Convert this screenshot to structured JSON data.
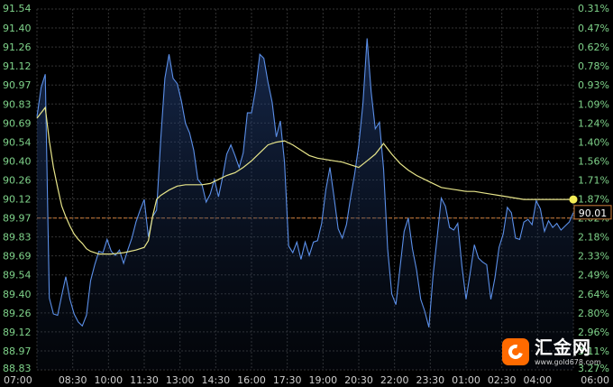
{
  "chart_data": {
    "type": "line",
    "y_ticks_left": [
      "91.54",
      "91.40",
      "91.26",
      "91.12",
      "90.97",
      "90.83",
      "90.69",
      "90.54",
      "90.40",
      "90.26",
      "90.12",
      "89.97",
      "89.83",
      "89.69",
      "89.54",
      "89.40",
      "89.26",
      "89.12",
      "88.97",
      "88.83"
    ],
    "y_ticks_right": [
      "0.31%",
      "0.47%",
      "0.62%",
      "0.78%",
      "0.93%",
      "1.09%",
      "1.24%",
      "1.40%",
      "1.56%",
      "1.71%",
      "1.87%",
      "2.02%",
      "2.18%",
      "2.33%",
      "2.49%",
      "2.64%",
      "2.80%",
      "2.96%",
      "3.11%",
      "3.27%"
    ],
    "x_ticks": [
      "07:00",
      "08:30",
      "10:00",
      "11:30",
      "13:00",
      "14:30",
      "16:00",
      "17:30",
      "19:00",
      "20:30",
      "22:00",
      "23:30",
      "01:00",
      "02:30",
      "04:00",
      "06:00"
    ],
    "ylim": [
      88.83,
      91.54
    ],
    "reference_value": 89.97,
    "current_value_label": "90.01",
    "grid": true,
    "series": [
      {
        "color": "#5b8fe8",
        "points": [
          [
            0,
            90.73
          ],
          [
            1,
            90.95
          ],
          [
            2,
            91.05
          ],
          [
            3,
            89.37
          ],
          [
            4,
            89.25
          ],
          [
            5,
            89.24
          ],
          [
            6,
            89.39
          ],
          [
            7,
            89.53
          ],
          [
            8,
            89.36
          ],
          [
            9,
            89.25
          ],
          [
            10,
            89.19
          ],
          [
            11,
            89.16
          ],
          [
            12,
            89.24
          ],
          [
            13,
            89.5
          ],
          [
            14,
            89.62
          ],
          [
            15,
            89.72
          ],
          [
            16,
            89.71
          ],
          [
            17,
            89.81
          ],
          [
            18,
            89.72
          ],
          [
            19,
            89.69
          ],
          [
            20,
            89.73
          ],
          [
            21,
            89.63
          ],
          [
            22,
            89.73
          ],
          [
            23,
            89.82
          ],
          [
            24,
            89.94
          ],
          [
            25,
            90.03
          ],
          [
            26,
            90.11
          ],
          [
            27,
            89.83
          ],
          [
            28,
            89.98
          ],
          [
            29,
            90.03
          ],
          [
            30,
            90.56
          ],
          [
            31,
            91.02
          ],
          [
            32,
            91.2
          ],
          [
            33,
            91.02
          ],
          [
            34,
            90.98
          ],
          [
            35,
            90.85
          ],
          [
            36,
            90.68
          ],
          [
            37,
            90.61
          ],
          [
            38,
            90.48
          ],
          [
            39,
            90.26
          ],
          [
            40,
            90.22
          ],
          [
            41,
            90.09
          ],
          [
            42,
            90.15
          ],
          [
            43,
            90.26
          ],
          [
            44,
            90.13
          ],
          [
            45,
            90.28
          ],
          [
            46,
            90.45
          ],
          [
            47,
            90.52
          ],
          [
            48,
            90.44
          ],
          [
            49,
            90.35
          ],
          [
            50,
            90.46
          ],
          [
            51,
            90.76
          ],
          [
            52,
            90.76
          ],
          [
            53,
            90.94
          ],
          [
            54,
            91.2
          ],
          [
            55,
            91.17
          ],
          [
            56,
            90.99
          ],
          [
            57,
            90.84
          ],
          [
            58,
            90.58
          ],
          [
            59,
            90.7
          ],
          [
            60,
            90.39
          ],
          [
            61,
            89.76
          ],
          [
            62,
            89.71
          ],
          [
            63,
            89.79
          ],
          [
            64,
            89.66
          ],
          [
            65,
            89.79
          ],
          [
            66,
            89.69
          ],
          [
            67,
            89.79
          ],
          [
            68,
            89.8
          ],
          [
            69,
            89.93
          ],
          [
            70,
            90.18
          ],
          [
            71,
            90.35
          ],
          [
            72,
            90.13
          ],
          [
            73,
            89.89
          ],
          [
            74,
            89.82
          ],
          [
            75,
            89.92
          ],
          [
            76,
            90.12
          ],
          [
            77,
            90.3
          ],
          [
            78,
            90.52
          ],
          [
            79,
            90.83
          ],
          [
            80,
            91.32
          ],
          [
            81,
            90.92
          ],
          [
            82,
            90.64
          ],
          [
            83,
            90.69
          ],
          [
            84,
            90.34
          ],
          [
            85,
            89.74
          ],
          [
            86,
            89.4
          ],
          [
            87,
            89.32
          ],
          [
            88,
            89.6
          ],
          [
            89,
            89.87
          ],
          [
            90,
            89.97
          ],
          [
            91,
            89.74
          ],
          [
            92,
            89.58
          ],
          [
            93,
            89.36
          ],
          [
            94,
            89.27
          ],
          [
            95,
            89.15
          ],
          [
            96,
            89.54
          ],
          [
            97,
            89.83
          ],
          [
            98,
            90.12
          ],
          [
            99,
            90.06
          ],
          [
            100,
            89.9
          ],
          [
            101,
            89.88
          ],
          [
            102,
            89.93
          ],
          [
            103,
            89.61
          ],
          [
            104,
            89.36
          ],
          [
            105,
            89.56
          ],
          [
            106,
            89.77
          ],
          [
            107,
            89.67
          ],
          [
            108,
            89.64
          ],
          [
            109,
            89.62
          ],
          [
            110,
            89.36
          ],
          [
            111,
            89.52
          ],
          [
            112,
            89.75
          ],
          [
            113,
            89.85
          ],
          [
            114,
            90.05
          ],
          [
            115,
            90.01
          ],
          [
            116,
            89.82
          ],
          [
            117,
            89.81
          ],
          [
            118,
            89.94
          ],
          [
            119,
            89.96
          ],
          [
            120,
            89.92
          ],
          [
            121,
            90.1
          ],
          [
            122,
            90.04
          ],
          [
            123,
            89.87
          ],
          [
            124,
            89.95
          ],
          [
            125,
            89.9
          ],
          [
            126,
            89.93
          ],
          [
            127,
            89.88
          ],
          [
            128,
            89.91
          ],
          [
            129,
            89.94
          ],
          [
            130,
            90.01
          ]
        ]
      },
      {
        "color": "#e7e58a",
        "points": [
          [
            0,
            90.72
          ],
          [
            2,
            90.8
          ],
          [
            3,
            90.55
          ],
          [
            4,
            90.35
          ],
          [
            5,
            90.2
          ],
          [
            6,
            90.06
          ],
          [
            7,
            89.98
          ],
          [
            8,
            89.91
          ],
          [
            9,
            89.85
          ],
          [
            10,
            89.81
          ],
          [
            11,
            89.78
          ],
          [
            12,
            89.74
          ],
          [
            13,
            89.72
          ],
          [
            14,
            89.71
          ],
          [
            15,
            89.7
          ],
          [
            18,
            89.7
          ],
          [
            21,
            89.71
          ],
          [
            24,
            89.73
          ],
          [
            26,
            89.75
          ],
          [
            27,
            89.8
          ],
          [
            28,
            89.98
          ],
          [
            29,
            90.11
          ],
          [
            30,
            90.14
          ],
          [
            32,
            90.18
          ],
          [
            34,
            90.21
          ],
          [
            36,
            90.22
          ],
          [
            38,
            90.22
          ],
          [
            40,
            90.22
          ],
          [
            42,
            90.23
          ],
          [
            44,
            90.26
          ],
          [
            46,
            90.29
          ],
          [
            48,
            90.31
          ],
          [
            50,
            90.35
          ],
          [
            52,
            90.4
          ],
          [
            54,
            90.46
          ],
          [
            56,
            90.52
          ],
          [
            58,
            90.54
          ],
          [
            60,
            90.55
          ],
          [
            62,
            90.52
          ],
          [
            64,
            90.48
          ],
          [
            66,
            90.44
          ],
          [
            68,
            90.42
          ],
          [
            70,
            90.41
          ],
          [
            72,
            90.4
          ],
          [
            74,
            90.39
          ],
          [
            76,
            90.37
          ],
          [
            78,
            90.35
          ],
          [
            80,
            90.4
          ],
          [
            82,
            90.45
          ],
          [
            84,
            90.53
          ],
          [
            86,
            90.45
          ],
          [
            88,
            90.38
          ],
          [
            90,
            90.33
          ],
          [
            92,
            90.29
          ],
          [
            94,
            90.26
          ],
          [
            96,
            90.23
          ],
          [
            98,
            90.2
          ],
          [
            100,
            90.19
          ],
          [
            102,
            90.18
          ],
          [
            104,
            90.17
          ],
          [
            106,
            90.17
          ],
          [
            108,
            90.16
          ],
          [
            110,
            90.15
          ],
          [
            112,
            90.14
          ],
          [
            114,
            90.13
          ],
          [
            116,
            90.12
          ],
          [
            118,
            90.11
          ],
          [
            120,
            90.11
          ],
          [
            122,
            90.11
          ],
          [
            124,
            90.11
          ],
          [
            126,
            90.11
          ],
          [
            128,
            90.11
          ],
          [
            130,
            90.11
          ]
        ]
      }
    ]
  },
  "brand": {
    "name": "汇金网",
    "url": "www.gold678.com",
    "accent": "#ff6a00"
  },
  "colors": {
    "grid": "#343434",
    "reference": "#cf7f3b",
    "price_line": "#5b8fe8",
    "avg_line": "#e7e58a",
    "marker": "#f5ee57"
  }
}
